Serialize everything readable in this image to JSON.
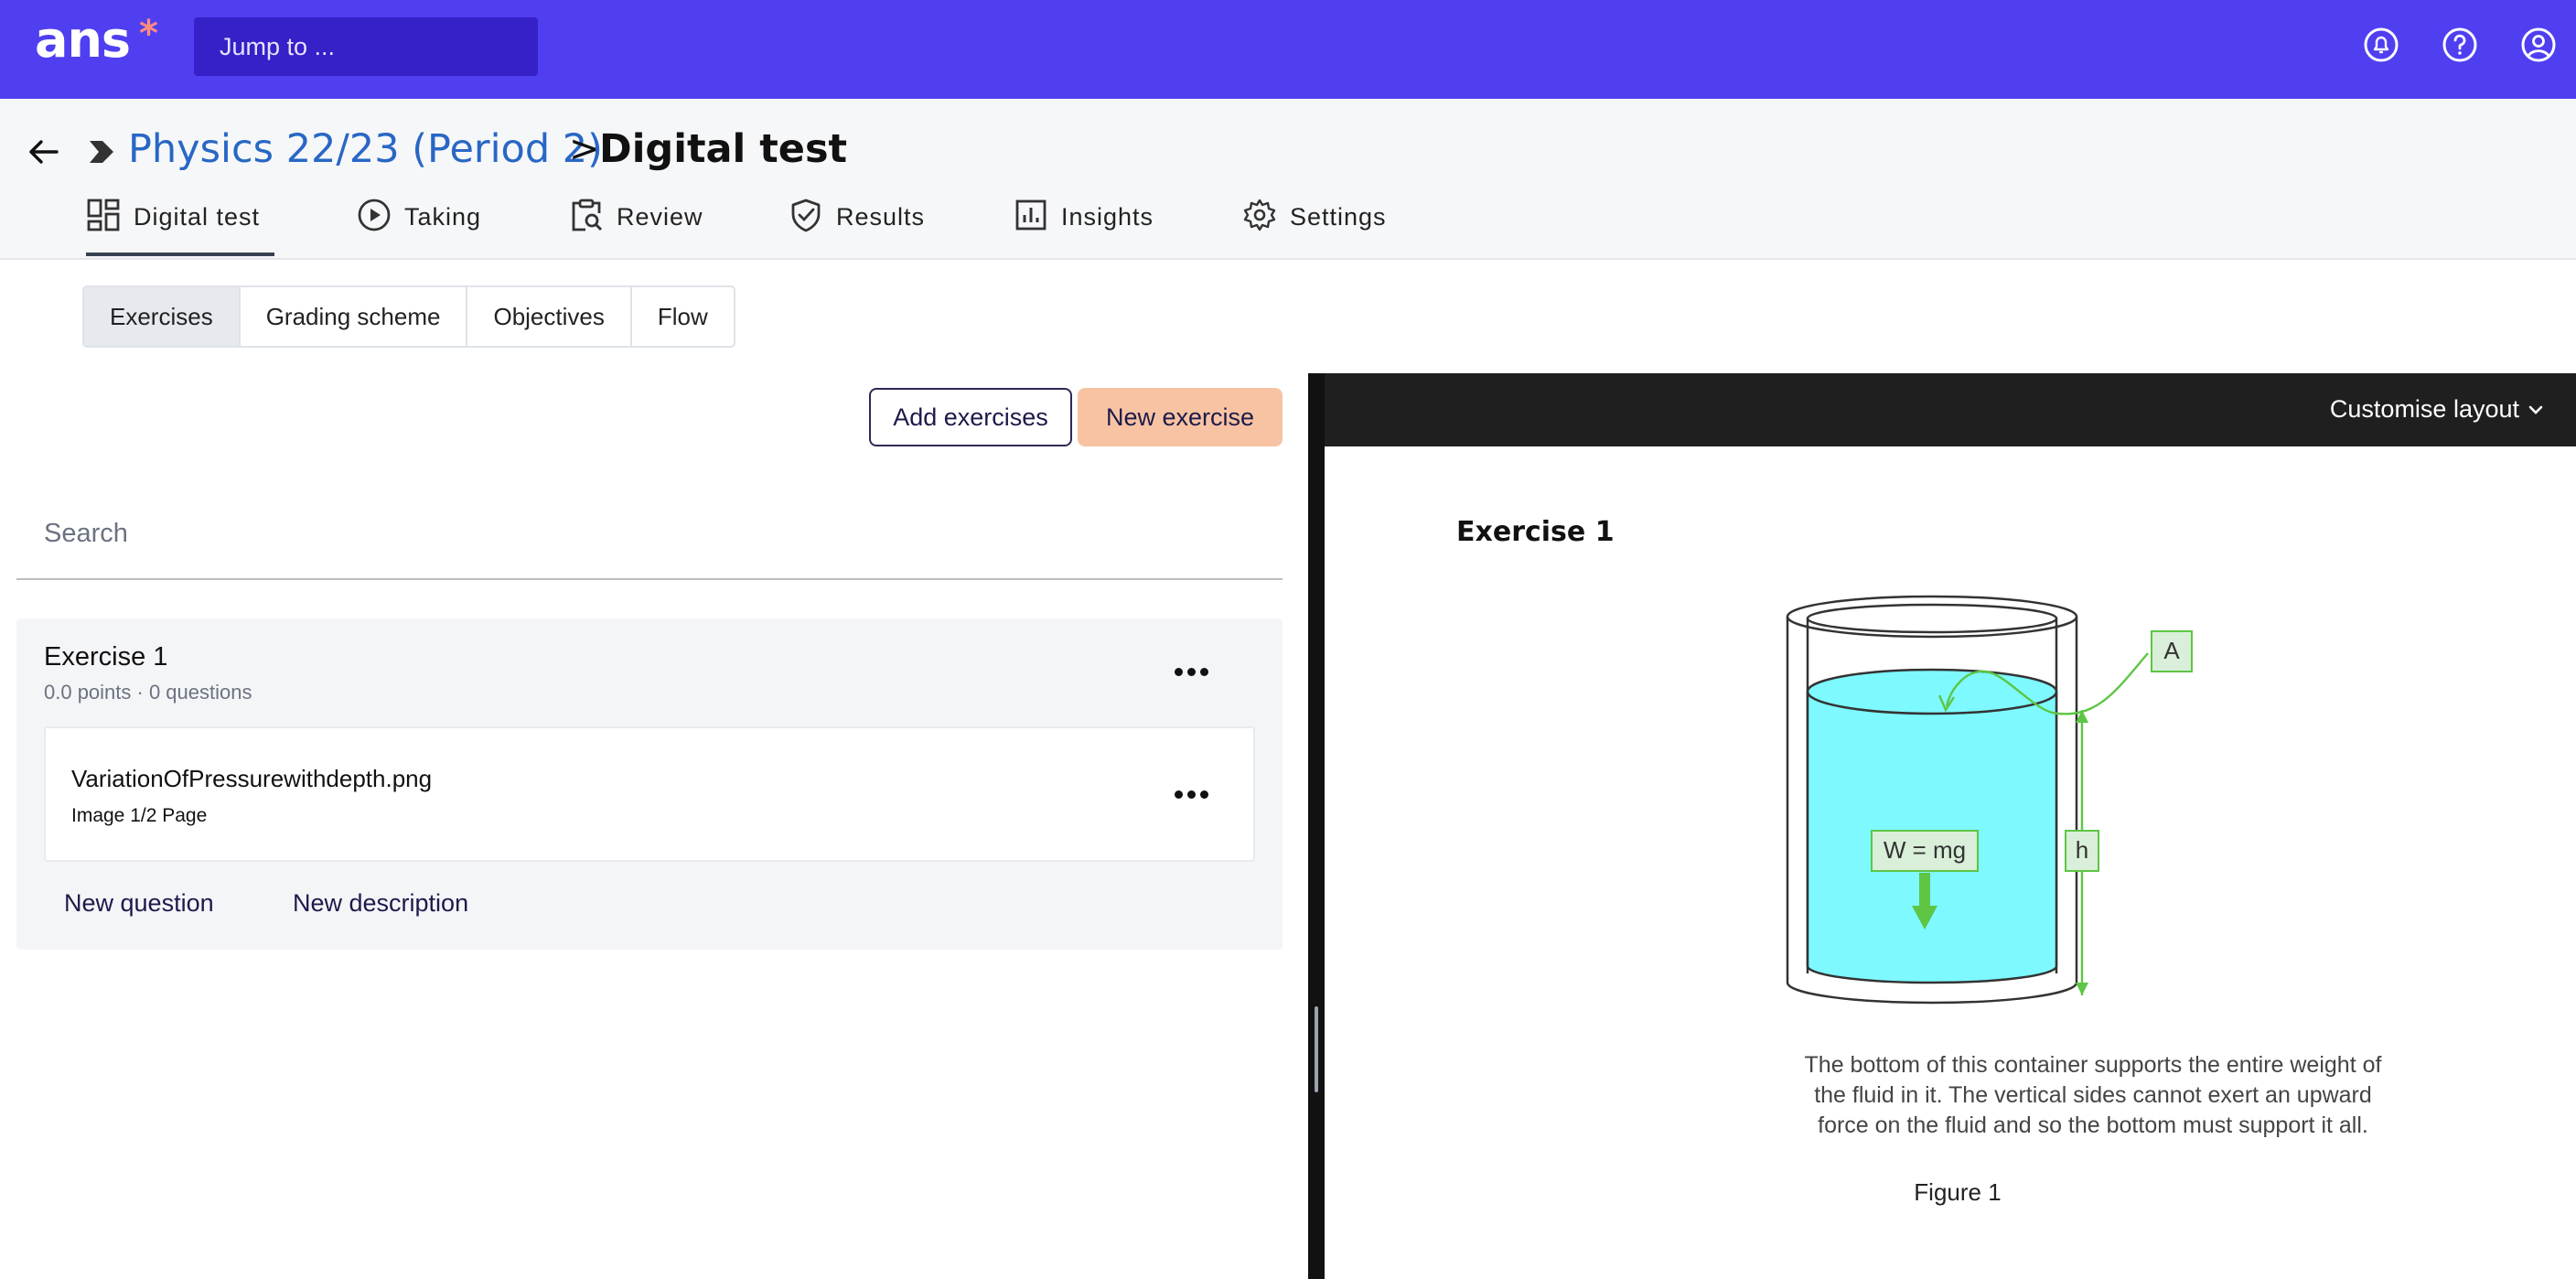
{
  "app": {
    "logo": "ans",
    "logo_mark": "*"
  },
  "topbar": {
    "jump_placeholder": "Jump to ...",
    "icons": [
      "notifications-icon",
      "help-icon",
      "account-icon"
    ]
  },
  "breadcrumb": {
    "course": "Physics 22/23 (Period 2)",
    "separator": ">",
    "current": "Digital test"
  },
  "tabs": [
    {
      "label": "Digital test",
      "icon": "dashboard-icon",
      "active": true
    },
    {
      "label": "Taking",
      "icon": "play-icon"
    },
    {
      "label": "Review",
      "icon": "clipboard-search-icon"
    },
    {
      "label": "Results",
      "icon": "shield-check-icon"
    },
    {
      "label": "Insights",
      "icon": "bar-chart-icon"
    },
    {
      "label": "Settings",
      "icon": "gear-icon"
    }
  ],
  "subtabs": [
    {
      "label": "Exercises",
      "active": true
    },
    {
      "label": "Grading scheme"
    },
    {
      "label": "Objectives"
    },
    {
      "label": "Flow"
    }
  ],
  "actions": {
    "add_exercises": "Add exercises",
    "new_exercise": "New exercise"
  },
  "search": {
    "placeholder": "Search"
  },
  "exercise": {
    "title": "Exercise 1",
    "meta": "0.0 points · 0 questions",
    "item": {
      "name": "VariationOfPressurewithdepth.png",
      "sub": "Image 1/2 Page"
    },
    "links": {
      "new_question": "New question",
      "new_description": "New description"
    }
  },
  "preview": {
    "layout_button": "Customise layout",
    "title": "Exercise 1",
    "figure_labels": {
      "a": "A",
      "weight": "W = mg",
      "h": "h"
    },
    "caption_lines": [
      "The bottom of this container supports the entire weight of",
      "the fluid in it. The vertical sides cannot exert an upward",
      "force on the fluid and so the bottom must support it all."
    ],
    "figure_label": "Figure 1"
  },
  "colors": {
    "topbar": "#4f3ff0",
    "link": "#2867c5",
    "primary_button": "#f7c3a2",
    "fluid": "#7df9ff",
    "annotation": "#5ec545"
  }
}
